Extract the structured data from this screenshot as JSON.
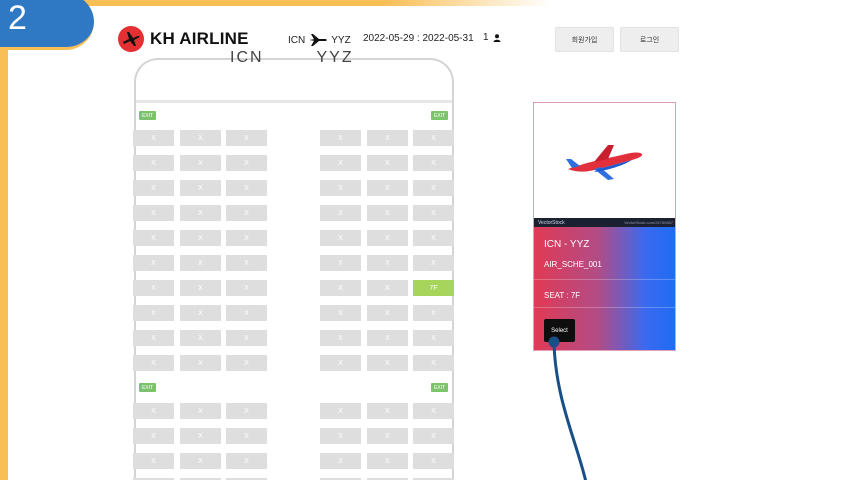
{
  "slide": {
    "step_number": "2"
  },
  "colors": {
    "accent_orange": "#f9bf57",
    "badge_blue": "#2f78c4",
    "brand_red": "#e43033",
    "seat_available": "#dedede",
    "seat_selected": "#a7d45b",
    "exit_green": "#7cc46b",
    "pointer_blue": "#174f86"
  },
  "header": {
    "logo_text": "KH AIRLINE",
    "logo_icon": "airplane-icon",
    "origin": "ICN",
    "destination": "YYZ",
    "route_icon": "airplane-icon",
    "dates": "2022-05-29 : 2022-05-31",
    "passengers": "1",
    "passenger_icon": "person-icon",
    "signup_label": "회원가입",
    "login_label": "로그인"
  },
  "seatmap": {
    "title_origin": "ICN",
    "title_destination": "YYZ",
    "exit_label": "EXIT",
    "seat_label": "X",
    "selected_seat": "7F"
  },
  "ticket": {
    "route": "ICN - YYZ",
    "schedule": "AIR_SCHE_001",
    "seat": "SEAT : 7F",
    "select_label": "Select",
    "image_brand": "VectorStock",
    "image_id": "VectorStock.com/24789887"
  }
}
